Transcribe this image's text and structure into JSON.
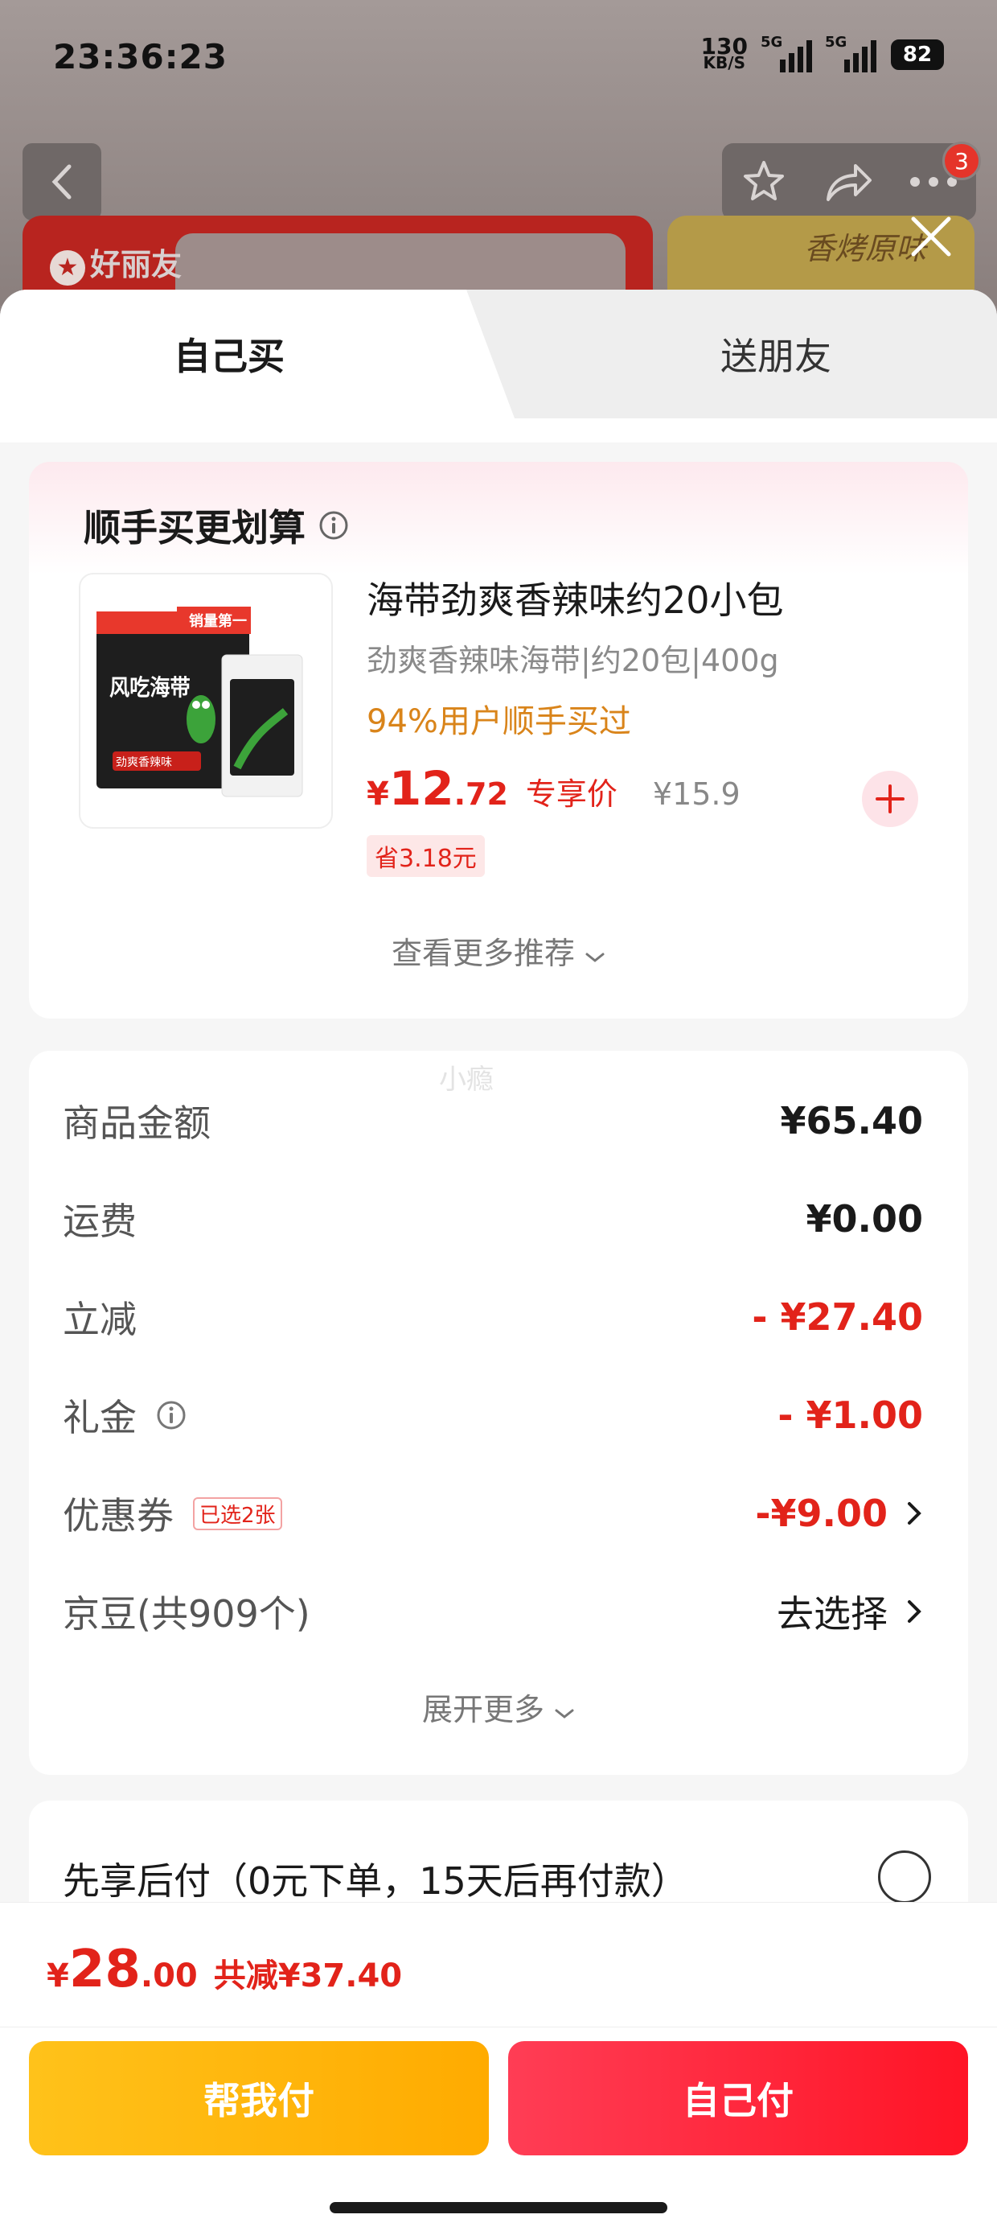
{
  "status_bar": {
    "time": "23:36:23",
    "net_speed_value": "130",
    "net_speed_unit": "KB/S",
    "signal1_label": "5G",
    "signal2_label": "5G",
    "battery": "82"
  },
  "background": {
    "brand_name": "好丽友",
    "banner_right_text": "香烤原味",
    "cart_badge_count": "3"
  },
  "tabs": {
    "self": "自己买",
    "friend": "送朋友"
  },
  "recommendation": {
    "title": "顺手买更划算",
    "product": {
      "name": "海带劲爽香辣味约20小包",
      "subtitle": "劲爽香辣味海带|约20包|400g",
      "buy_rate": "94%用户顺手买过",
      "price_symbol": "¥",
      "price_int": "12",
      "price_dec": ".72",
      "price_tag": "专享价",
      "original_price": "¥15.9",
      "save_label": "省3.18元",
      "image_text_top": "销量第一",
      "image_text_main": "风吃海带",
      "image_text_flavor": "劲爽香辣味"
    },
    "more_label": "查看更多推荐"
  },
  "summary": {
    "watermark": "小瘾",
    "rows": [
      {
        "label": "商品金额",
        "value": "¥65.40"
      },
      {
        "label": "运费",
        "value": "¥0.00"
      },
      {
        "label": "立减",
        "value": "- ¥27.40"
      },
      {
        "label": "礼金",
        "value": "- ¥1.00"
      },
      {
        "label": "优惠券",
        "chip": "已选2张",
        "value": "-¥9.00"
      },
      {
        "label": "京豆(共909个)",
        "value": "去选择"
      }
    ],
    "expand_label": "展开更多"
  },
  "pay_later": {
    "label": "先享后付（0元下单，15天后再付款）"
  },
  "footer": {
    "total_symbol": "¥",
    "total_int": "28",
    "total_dec": ".00",
    "total_saved": "共减¥37.40",
    "help_pay_button": "帮我付",
    "self_pay_button": "自己付"
  },
  "colors": {
    "accent_red": "#e2231a",
    "help_button": "#ffb300",
    "self_button": "#ff2a3e",
    "rate_orange": "#d9841a"
  }
}
